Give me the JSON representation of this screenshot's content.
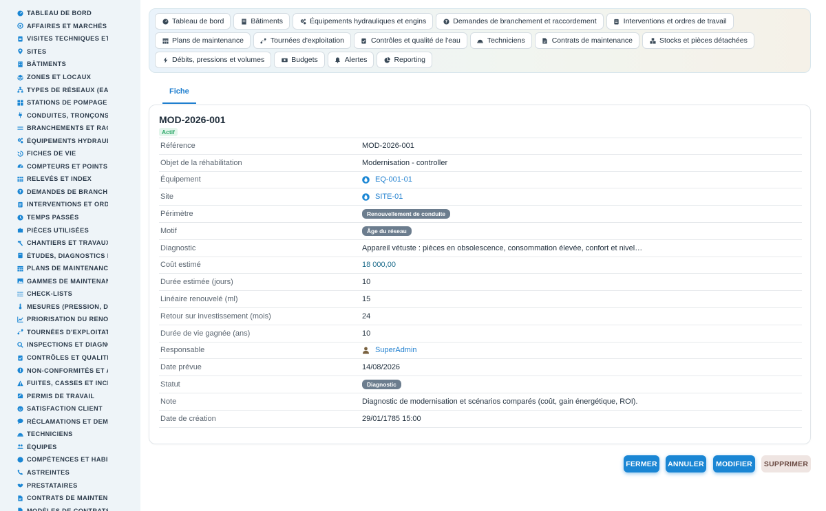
{
  "sidebar": {
    "items": [
      {
        "label": "TABLEAU DE BORD",
        "icon": "dashboard-icon"
      },
      {
        "label": "AFFAIRES ET MARCHÉS",
        "icon": "target-icon"
      },
      {
        "label": "VISITES TECHNIQUES ET",
        "icon": "clipboard-icon"
      },
      {
        "label": "SITES",
        "icon": "location-pin-icon"
      },
      {
        "label": "BÂTIMENTS",
        "icon": "building-icon"
      },
      {
        "label": "ZONES ET LOCAUX",
        "icon": "layers-icon"
      },
      {
        "label": "TYPES DE RÉSEAUX (EAU",
        "icon": "network-icon"
      },
      {
        "label": "STATIONS DE POMPAGE E",
        "icon": "grid-icon"
      },
      {
        "label": "CONDUITES, TRONÇONS",
        "icon": "plug-icon"
      },
      {
        "label": "BRANCHEMENTS ET RAC",
        "icon": "lines-icon"
      },
      {
        "label": "ÉQUIPEMENTS HYDRAUL",
        "icon": "gears-icon"
      },
      {
        "label": "FICHES DE VIE",
        "icon": "history-icon"
      },
      {
        "label": "COMPTEURS ET POINTS D",
        "icon": "gauge-icon"
      },
      {
        "label": "RELEVÉS ET INDEX",
        "icon": "table-icon"
      },
      {
        "label": "DEMANDES DE BRANCHE",
        "icon": "question-icon"
      },
      {
        "label": "INTERVENTIONS ET ORDR",
        "icon": "list-icon"
      },
      {
        "label": "TEMPS PASSÉS",
        "icon": "clock-icon"
      },
      {
        "label": "PIÈCES UTILISÉES",
        "icon": "puzzle-icon"
      },
      {
        "label": "CHANTIERS ET TRAVAUX",
        "icon": "hammer-icon"
      },
      {
        "label": "ÉTUDES, DIAGNOSTICS E",
        "icon": "book-icon"
      },
      {
        "label": "PLANS DE MAINTENANCE",
        "icon": "calendar-grid-icon"
      },
      {
        "label": "GAMMES DE MAINTENAN",
        "icon": "image-icon"
      },
      {
        "label": "CHECK-LISTS",
        "icon": "checklist-icon"
      },
      {
        "label": "MESURES (PRESSION, DÉ",
        "icon": "thermometer-icon"
      },
      {
        "label": "PRIORISATION DU RENOU",
        "icon": "chart-line-icon"
      },
      {
        "label": "TOURNÉES D'EXPLOITATI",
        "icon": "route-icon"
      },
      {
        "label": "INSPECTIONS ET DIAGNO",
        "icon": "search-icon"
      },
      {
        "label": "CONTRÔLES ET QUALITÉ",
        "icon": "clipboard-check-icon"
      },
      {
        "label": "NON-CONFORMITÉS ET A",
        "icon": "alert-circle-icon"
      },
      {
        "label": "FUITES, CASSES ET INCIE",
        "icon": "warning-icon"
      },
      {
        "label": "PERMIS DE TRAVAIL",
        "icon": "license-icon"
      },
      {
        "label": "SATISFACTION CLIENT",
        "icon": "smile-icon"
      },
      {
        "label": "RÉCLAMATIONS ET DEMA",
        "icon": "comment-icon"
      },
      {
        "label": "TECHNICIENS",
        "icon": "helmet-icon"
      },
      {
        "label": "ÉQUIPES",
        "icon": "users-icon"
      },
      {
        "label": "COMPÉTENCES ET HABIL",
        "icon": "certificate-icon"
      },
      {
        "label": "ASTREINTES",
        "icon": "phone-icon"
      },
      {
        "label": "PRESTATAIRES",
        "icon": "handshake-icon"
      },
      {
        "label": "CONTRATS DE MAINTENA",
        "icon": "file-contract-icon"
      },
      {
        "label": "MODÈLES DE CONTRATS",
        "icon": "file-icon"
      }
    ]
  },
  "nav": {
    "buttons": [
      {
        "label": "Tableau de bord",
        "icon": "dashboard-icon"
      },
      {
        "label": "Bâtiments",
        "icon": "building-icon"
      },
      {
        "label": "Équipements hydrauliques et engins",
        "icon": "gears-icon"
      },
      {
        "label": "Demandes de branchement et raccordement",
        "icon": "question-icon"
      },
      {
        "label": "Interventions et ordres de travail",
        "icon": "clipboard-icon"
      },
      {
        "label": "Plans de maintenance",
        "icon": "calendar-grid-icon"
      },
      {
        "label": "Tournées d'exploitation",
        "icon": "route-icon"
      },
      {
        "label": "Contrôles et qualité de l'eau",
        "icon": "clipboard-check-icon"
      },
      {
        "label": "Techniciens",
        "icon": "helmet-icon"
      },
      {
        "label": "Contrats de maintenance",
        "icon": "file-contract-icon"
      },
      {
        "label": "Stocks et pièces détachées",
        "icon": "boxes-icon"
      },
      {
        "label": "Débits, pressions et volumes",
        "icon": "bolt-icon"
      },
      {
        "label": "Budgets",
        "icon": "money-icon"
      },
      {
        "label": "Alertes",
        "icon": "bell-icon"
      },
      {
        "label": "Reporting",
        "icon": "pie-chart-icon"
      }
    ]
  },
  "tabs": {
    "fiche": "Fiche"
  },
  "record": {
    "title": "MOD-2026-001",
    "status_badge": "Actif",
    "fields": [
      {
        "label": "Référence",
        "value": "MOD-2026-001",
        "kind": "text"
      },
      {
        "label": "Objet de la réhabilitation",
        "value": "Modernisation - controller",
        "kind": "text"
      },
      {
        "label": "Équipement",
        "value": "EQ-001-01",
        "kind": "link",
        "icon": "water-drop-icon"
      },
      {
        "label": "Site",
        "value": "SITE-01",
        "kind": "link",
        "icon": "water-drop-icon"
      },
      {
        "label": "Périmètre",
        "value": "Renouvellement de conduite",
        "kind": "pill"
      },
      {
        "label": "Motif",
        "value": "Âge du réseau",
        "kind": "pill"
      },
      {
        "label": "Diagnostic",
        "value": "Appareil vétuste : pièces en obsolescence, consommation élevée, confort et nivel…",
        "kind": "text"
      },
      {
        "label": "Coût estimé",
        "value": "18 000,00",
        "kind": "money"
      },
      {
        "label": "Durée estimée (jours)",
        "value": "10",
        "kind": "text"
      },
      {
        "label": "Linéaire renouvelé (ml)",
        "value": "15",
        "kind": "text"
      },
      {
        "label": "Retour sur investissement (mois)",
        "value": "24",
        "kind": "text"
      },
      {
        "label": "Durée de vie gagnée (ans)",
        "value": "10",
        "kind": "text"
      },
      {
        "label": "Responsable",
        "value": "SuperAdmin",
        "kind": "link",
        "icon": "user-icon"
      },
      {
        "label": "Date prévue",
        "value": "14/08/2026",
        "kind": "text"
      },
      {
        "label": "Statut",
        "value": "Diagnostic",
        "kind": "pill"
      },
      {
        "label": "Note",
        "value": "Diagnostic de modernisation et scénarios comparés (coût, gain énergétique, ROI).",
        "kind": "text"
      },
      {
        "label": "Date de création",
        "value": "29/01/1785 15:00",
        "kind": "text"
      }
    ]
  },
  "actions": {
    "close": "FERMER",
    "cancel": "ANNULER",
    "edit": "MODIFIER",
    "delete": "SUPPRIMER"
  },
  "colors": {
    "primary": "#1a86d4",
    "sidebar_bg": "#eef4f8",
    "sidebar_icon": "#1a86d4",
    "pill_bg": "#6c7d8e",
    "active_badge": "#2ea86a"
  }
}
